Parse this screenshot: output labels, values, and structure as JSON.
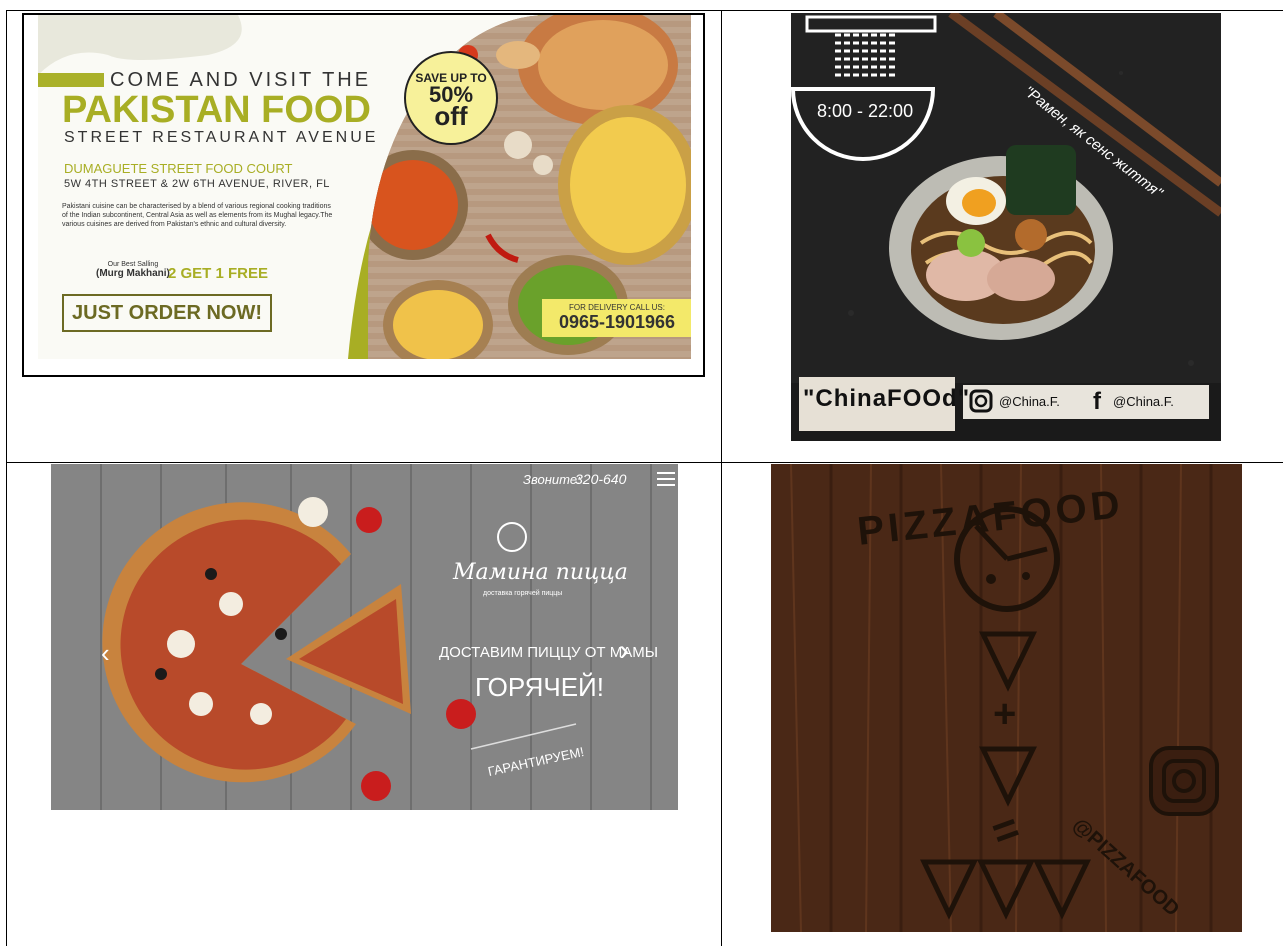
{
  "panel1": {
    "line1": "COME AND VISIT THE",
    "line2": "PAKISTAN FOOD",
    "line3": "STREET RESTAURANT AVENUE",
    "court": "DUMAGUETE STREET FOOD COURT",
    "address": "5W 4TH STREET & 2W 6TH AVENUE, RIVER, FL",
    "description": "Pakistani cuisine can be characterised by a blend of various regional cooking traditions of the Indian subcontinent, Central Asia as well as elements from its Mughal legacy.The various cuisines are derived from Pakistan's ethnic and cultural diversity.",
    "best_label": "Our Best Salling",
    "best_item": "(Murg Makhani)",
    "offer": "2 GET 1 FREE",
    "cta": "JUST ORDER NOW!",
    "badge_line1": "SAVE UP TO",
    "badge_line2": "50%",
    "badge_line3": "off",
    "call_label": "FOR DELIVERY CALL US:",
    "phone": "0965-1901966",
    "accent": "#a8ae24"
  },
  "panel2": {
    "hours": "8:00 - 22:00",
    "slogan": "\"Рамен, як сенс життя\"",
    "brand": "\"ChinaFOOd\"",
    "instagram": "@China.F.",
    "facebook": "@China.F."
  },
  "panel3": {
    "phone_label": "Звоните:",
    "phone": "320-640",
    "brand": "Мамина пицца",
    "brand_sub": "доставка горячей пиццы",
    "line1": "ДОСТАВИМ ПИЦЦУ ОТ МАМЫ",
    "line2": "ГОРЯЧЕЙ!",
    "line3": "ГАРАНТИРУЕМ!"
  },
  "panel4": {
    "arc_title": "PIZZAFOOD",
    "handle": "@PIZZAFOOD",
    "plus": "+",
    "equals": "="
  }
}
